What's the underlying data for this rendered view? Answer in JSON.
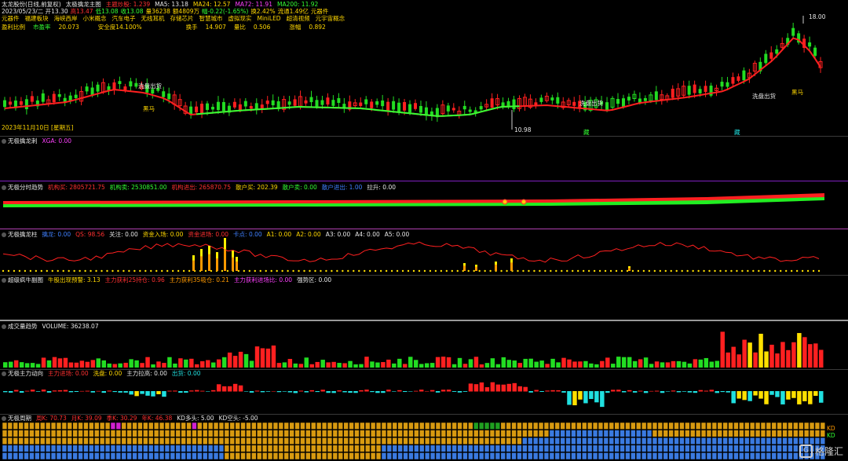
{
  "header": {
    "line1": [
      "太龙股份(日线,前复权)",
      "太极擒龙主图",
      "主题炒股: 1.239",
      "MA5: 13.18",
      "MA24: 12.57",
      "MA72: 11.91",
      "MA200: 11.92"
    ],
    "line2": [
      "2023/05/23/二 开13.30",
      "高13.47",
      "低13.08",
      "收13.08",
      "量36238",
      "额4809万",
      "幅-0.22(-1.65%)",
      "换2.42%",
      "流通1.49亿",
      "元器件"
    ],
    "line3": [
      "元器件",
      "福建板块",
      "海峡西岸",
      "小米概念",
      "汽车电子",
      "无线耳机",
      "存储芯片",
      "智慧城市",
      "虚拟现实",
      "MiniLED",
      "超清视频",
      "元宇宙概念"
    ],
    "line4": [
      "盈利比例",
      "市盈率",
      "20.073",
      "安全度14.100%",
      "换手",
      "14.907",
      "量比",
      "0.506",
      "涨幅",
      "0.892"
    ]
  },
  "main_chart": {
    "price_high_label": "18.00",
    "price_low_label": "10.98",
    "date_label": "2023年11月10日 [星期五]",
    "annotations": [
      "洗盘出货",
      "洗盘出货",
      "洗盘出货",
      "黑马",
      "黑马"
    ],
    "markers": [
      "藏",
      "藏"
    ]
  },
  "panels": [
    {
      "id": "p1",
      "title": "无极擒龙刺",
      "values": [
        "XGA: 0.00"
      ]
    },
    {
      "id": "p2",
      "title": "无极分时趋势",
      "values": [
        "机构买: 2805721.75",
        "机构卖: 2530851.00",
        "机构进出: 265870.75",
        "散户买: 202.39",
        "散户卖: 0.00",
        "散户进出: 1.00",
        "拉升: 0.00"
      ]
    },
    {
      "id": "p3",
      "title": "无极擒龙柱",
      "values": [
        "擒龙: 0.00",
        "QS: 98.56",
        "关注: 0.00",
        "资金入场: 0.00",
        "资金进场: 0.00",
        "卡点: 0.00",
        "A1: 0.00",
        "A2: 0.00",
        "A3: 0.00",
        "A4: 0.00",
        "A5: 0.00"
      ]
    },
    {
      "id": "p4",
      "title": "超级疯牛副图",
      "values": [
        "牛股出现预警: 3.13",
        "主力获利25持仓: 0.96",
        "主力获利35吸仓: 0.21",
        "主力获利进场比: 0.00",
        "强势区: 0.00"
      ]
    },
    {
      "id": "p5",
      "title": "成交量趋势",
      "values": [
        "VOLUME: 36238.07"
      ]
    },
    {
      "id": "p6",
      "title": "无极主力动向",
      "values": [
        "主力进场: 0.00",
        "洗盘: 0.00",
        "主力拉高: 0.00",
        "出货: 0.00"
      ]
    },
    {
      "id": "p7",
      "title": "无极周期",
      "values": [
        "周K: 70.73",
        "月K: 39.09",
        "季K: 30.29",
        "年K: 46.38",
        "KD多头: 5.00",
        "KD空头: -5.00"
      ]
    }
  ],
  "right_tags": [
    "KD",
    "KD"
  ],
  "watermark": "格隆汇",
  "colors": {
    "up": "#ff2020",
    "down": "#22dd22",
    "ma": "#ff2020",
    "ma_green": "#33ff33",
    "yellow": "#ffe000",
    "cyan": "#20e0e0",
    "magenta": "#d020d0"
  }
}
